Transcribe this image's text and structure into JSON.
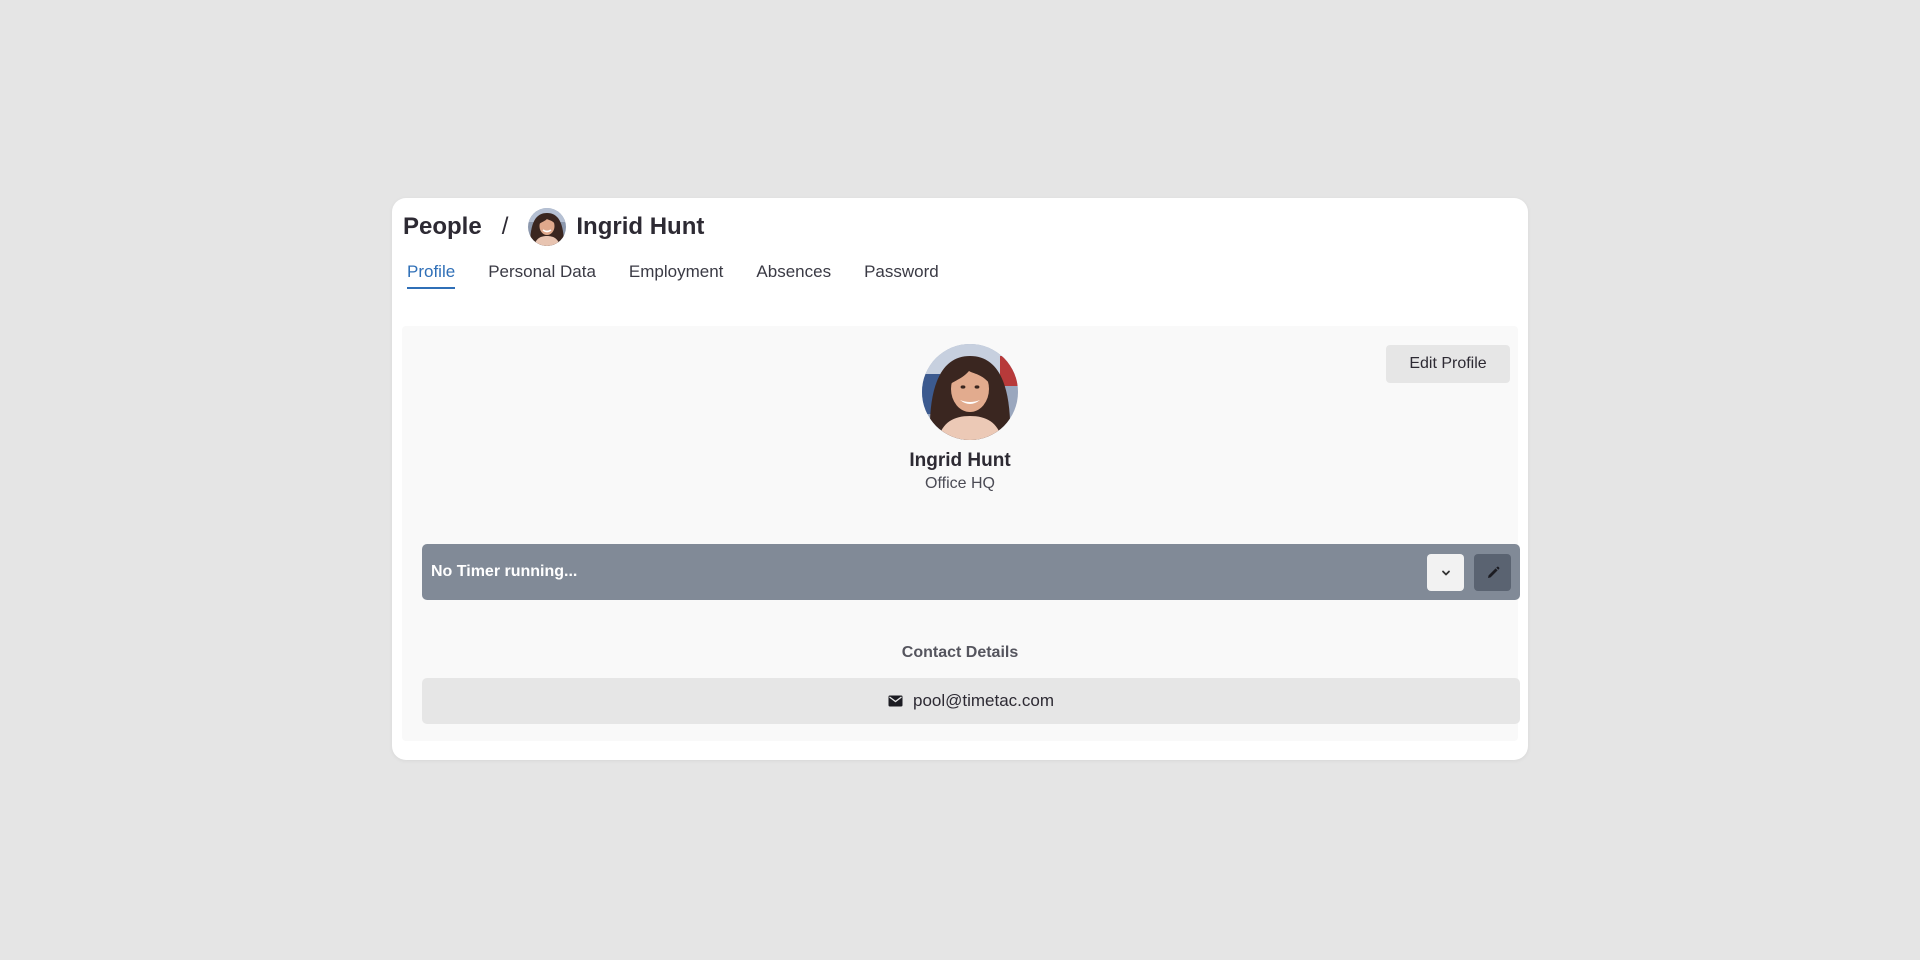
{
  "breadcrumb": {
    "root": "People",
    "separator": "/",
    "current": "Ingrid Hunt"
  },
  "tabs": [
    {
      "label": "Profile",
      "active": true
    },
    {
      "label": "Personal Data",
      "active": false
    },
    {
      "label": "Employment",
      "active": false
    },
    {
      "label": "Absences",
      "active": false
    },
    {
      "label": "Password",
      "active": false
    }
  ],
  "profile": {
    "edit_label": "Edit Profile",
    "name": "Ingrid Hunt",
    "location": "Office HQ"
  },
  "timer": {
    "status": "No Timer running...",
    "dropdown_icon": "chevron-down-icon",
    "edit_icon": "pencil-icon"
  },
  "contact": {
    "title": "Contact Details",
    "email_icon": "envelope-icon",
    "email": "pool@timetac.com"
  },
  "colors": {
    "accent": "#2f6fb7",
    "timer_bar": "#818a97",
    "timer_edit_button": "#5a6371",
    "background": "#e5e5e5"
  }
}
